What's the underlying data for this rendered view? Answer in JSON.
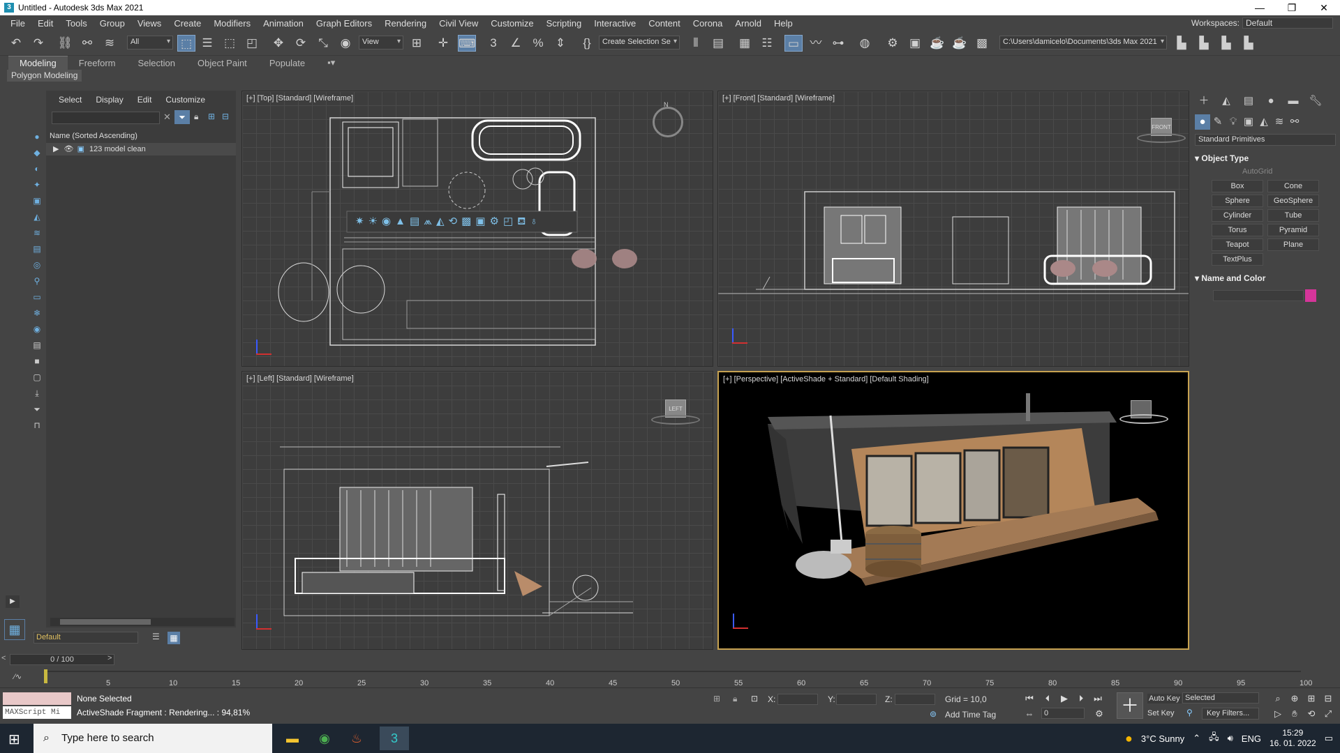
{
  "window": {
    "title": "Untitled - Autodesk 3ds Max 2021",
    "app_icon": "3",
    "minimize": "—",
    "maximize": "❐",
    "close": "✕"
  },
  "menu": [
    "File",
    "Edit",
    "Tools",
    "Group",
    "Views",
    "Create",
    "Modifiers",
    "Animation",
    "Graph Editors",
    "Rendering",
    "Civil View",
    "Customize",
    "Scripting",
    "Interactive",
    "Content",
    "Corona",
    "Arnold",
    "Help"
  ],
  "workspace": {
    "label": "Workspaces:",
    "value": "Default"
  },
  "toolbar": {
    "selection_filter": "All",
    "ref_coord": "View",
    "named_selection": "Create Selection Se",
    "project_path": "C:\\Users\\damicelo\\Documents\\3ds Max 2021"
  },
  "ribbon": {
    "tabs": [
      "Modeling",
      "Freeform",
      "Selection",
      "Object Paint",
      "Populate"
    ],
    "active": "Modeling",
    "subpanel": "Polygon Modeling"
  },
  "explorer": {
    "tabs": [
      "Select",
      "Display",
      "Edit",
      "Customize"
    ],
    "column_header": "Name (Sorted Ascending)",
    "rows": [
      {
        "name": "123 model clean"
      }
    ],
    "layer": "Default"
  },
  "viewports": {
    "top": {
      "label": "[+] [Top] [Standard] [Wireframe]",
      "cube_label": "N"
    },
    "front": {
      "label": "[+] [Front] [Standard] [Wireframe]",
      "cube_label": "FRONT"
    },
    "left": {
      "label": "[+] [Left] [Standard] [Wireframe]",
      "cube_label": "LEFT"
    },
    "perspective": {
      "label": "[+] [Perspective] [ActiveShade + Standard] [Default Shading]"
    }
  },
  "command_panel": {
    "dropdown": "Standard Primitives",
    "object_type_title": "Object Type",
    "autogrid": "AutoGrid",
    "primitives": [
      "Box",
      "Cone",
      "Sphere",
      "GeoSphere",
      "Cylinder",
      "Tube",
      "Torus",
      "Pyramid",
      "Teapot",
      "Plane",
      "TextPlus"
    ],
    "name_color_title": "Name and Color",
    "swatch_color": "#d6359a"
  },
  "timeline": {
    "slider": "0 / 100",
    "ticks": [
      "5",
      "10",
      "15",
      "20",
      "25",
      "30",
      "35",
      "40",
      "45",
      "50",
      "55",
      "60",
      "65",
      "70",
      "75",
      "80",
      "85",
      "90",
      "95",
      "100"
    ]
  },
  "status": {
    "selection": "None Selected",
    "prompt": "ActiveShade Fragment : Rendering... : 94,81%",
    "maxscript": "MAXScript Mi",
    "x_label": "X:",
    "y_label": "Y:",
    "z_label": "Z:",
    "grid": "Grid = 10,0",
    "add_time_tag": "Add Time Tag",
    "auto_key": "Auto Key",
    "set_key": "Set Key",
    "key_mode": "Selected",
    "key_filters": "Key Filters...",
    "frame": "0"
  },
  "taskbar": {
    "search_placeholder": "Type here to search",
    "weather": "3°C  Sunny",
    "language": "ENG",
    "time": "15:29",
    "date": "16. 01. 2022"
  }
}
